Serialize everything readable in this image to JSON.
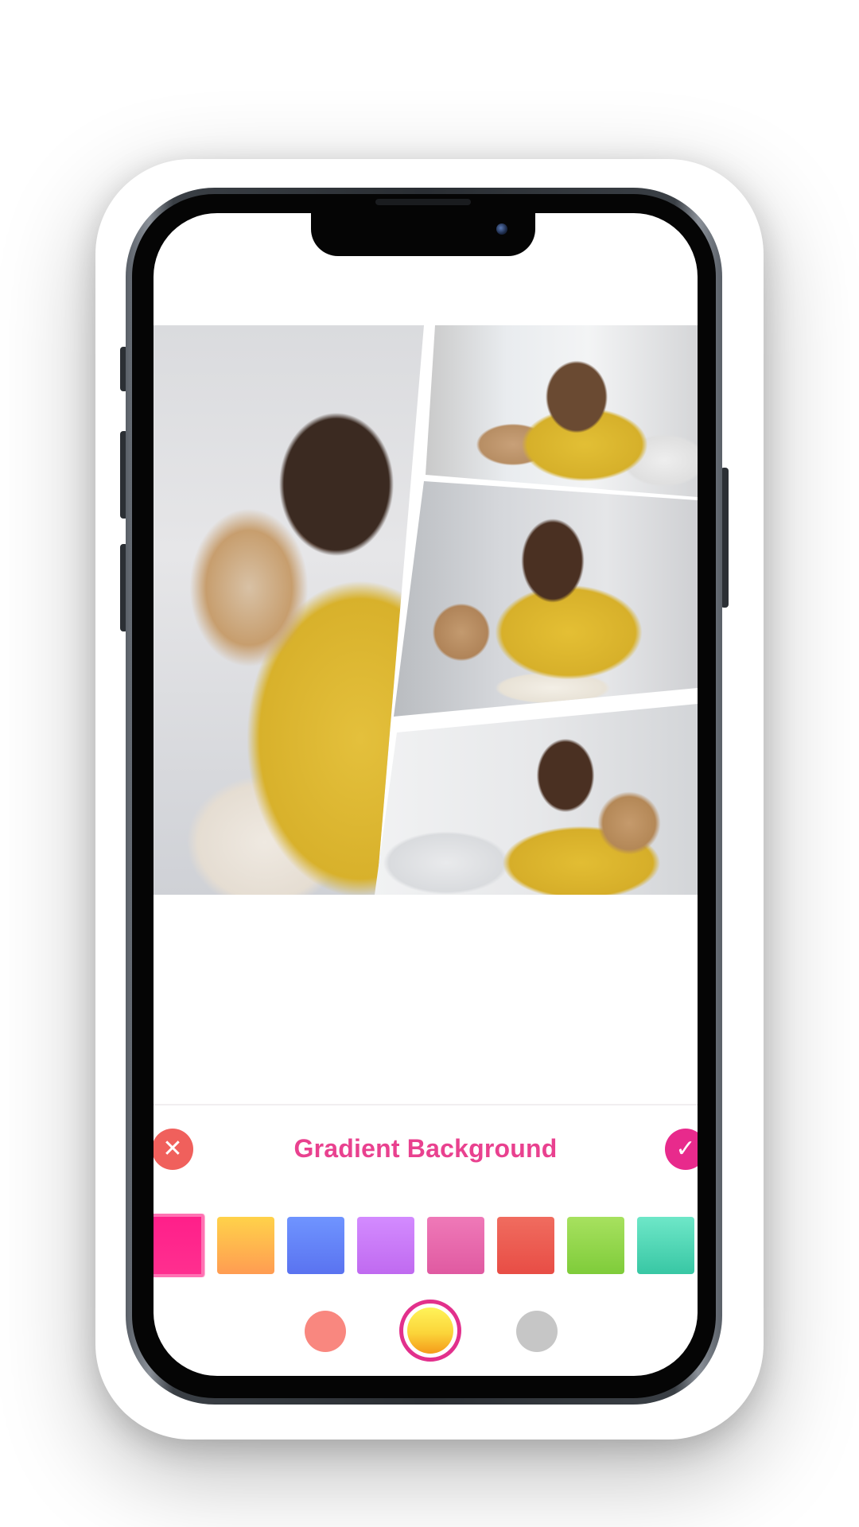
{
  "editor": {
    "panel_title": "Gradient Background",
    "cancel_icon": "close-icon",
    "confirm_icon": "check-icon",
    "cancel_glyph": "✕",
    "confirm_glyph": "✓"
  },
  "collage": {
    "photos": [
      {
        "description_icon": "photo",
        "name": "collage-photo-large-left"
      },
      {
        "description_icon": "photo",
        "name": "collage-photo-top-right"
      },
      {
        "description_icon": "photo",
        "name": "collage-photo-middle-right"
      },
      {
        "description_icon": "photo",
        "name": "collage-photo-bottom-right"
      }
    ]
  },
  "gradient_swatches": [
    {
      "top": "#ff1f8a",
      "bottom": "#ff2f8f",
      "selected": true
    },
    {
      "top": "#ffd24a",
      "bottom": "#ff9c52",
      "selected": false
    },
    {
      "top": "#6f94ff",
      "bottom": "#5a73f0",
      "selected": false
    },
    {
      "top": "#d38bff",
      "bottom": "#c06af0",
      "selected": false
    },
    {
      "top": "#ef79b8",
      "bottom": "#e05aa1",
      "selected": false
    },
    {
      "top": "#f06c5f",
      "bottom": "#e84d45",
      "selected": false
    },
    {
      "top": "#a7e15f",
      "bottom": "#7fcc3a",
      "selected": false
    },
    {
      "top": "#6ee7c8",
      "bottom": "#38c7a4",
      "selected": false
    }
  ],
  "gradient_type_dots": [
    {
      "color": "#f9877f",
      "selected": false
    },
    {
      "color": "gradient-yellow-orange",
      "selected": true
    },
    {
      "color": "#c6c6c6",
      "selected": false
    }
  ],
  "colors": {
    "accent": "#e82a8c",
    "title_text": "#e9418f",
    "cancel": "#f0605c"
  }
}
